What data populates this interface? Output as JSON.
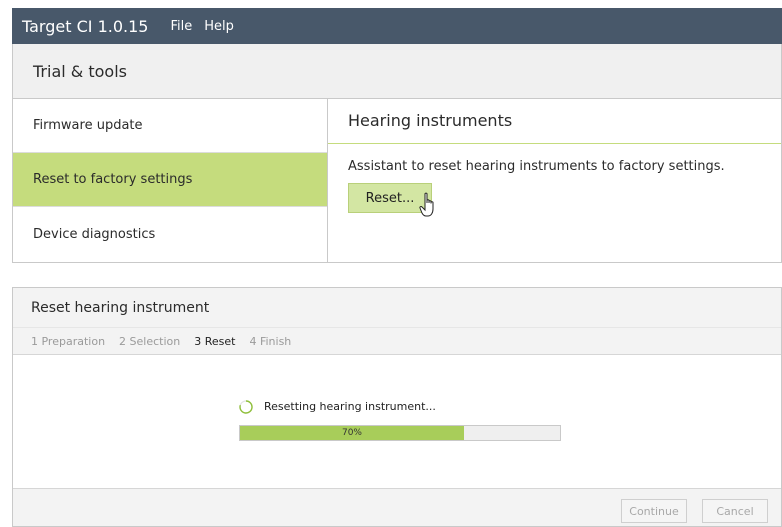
{
  "app": {
    "title": "Target CI 1.0.15",
    "menu": [
      "File",
      "Help"
    ]
  },
  "section": {
    "title": "Trial & tools"
  },
  "sidebar": {
    "items": [
      {
        "label": "Firmware update",
        "active": false
      },
      {
        "label": "Reset to factory settings",
        "active": true
      },
      {
        "label": "Device diagnostics",
        "active": false
      }
    ]
  },
  "detail": {
    "title": "Hearing instruments",
    "description": "Assistant to reset hearing instruments to factory settings.",
    "reset_button": "Reset..."
  },
  "wizard": {
    "title": "Reset hearing instrument",
    "steps": [
      {
        "label": "1 Preparation",
        "current": false
      },
      {
        "label": "2 Selection",
        "current": false
      },
      {
        "label": "3 Reset",
        "current": true
      },
      {
        "label": "4 Finish",
        "current": false
      }
    ],
    "status": "Resetting hearing instrument...",
    "progress": 70,
    "progress_label": "70%",
    "continue_button": "Continue",
    "cancel_button": "Cancel"
  },
  "colors": {
    "titlebar": "#48586a",
    "accent_green": "#c5dc7d",
    "progress_green": "#a8cd5a"
  },
  "icons": {
    "spinner": "loading-spinner-icon",
    "cursor": "hand-pointer-icon"
  }
}
